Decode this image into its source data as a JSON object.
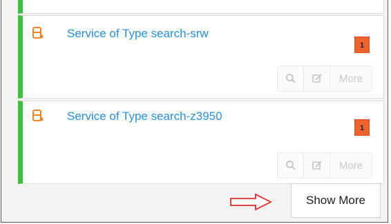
{
  "services": [
    {
      "title": "Service of Type search-srw",
      "count": "1",
      "icon": "service-icon",
      "actions": {
        "search_icon": "magnifier-icon",
        "edit_icon": "edit-icon",
        "more_label": "More"
      }
    },
    {
      "title": "Service of Type search-z3950",
      "count": "1",
      "icon": "service-icon",
      "actions": {
        "search_icon": "magnifier-icon",
        "edit_icon": "edit-icon",
        "more_label": "More"
      }
    }
  ],
  "show_more_label": "Show More",
  "colors": {
    "accent_bar": "#3fbf3f",
    "link": "#2a8fd6",
    "badge": "#f0632f",
    "service_icon": "#f08020",
    "arrow": "#d92b2b"
  }
}
